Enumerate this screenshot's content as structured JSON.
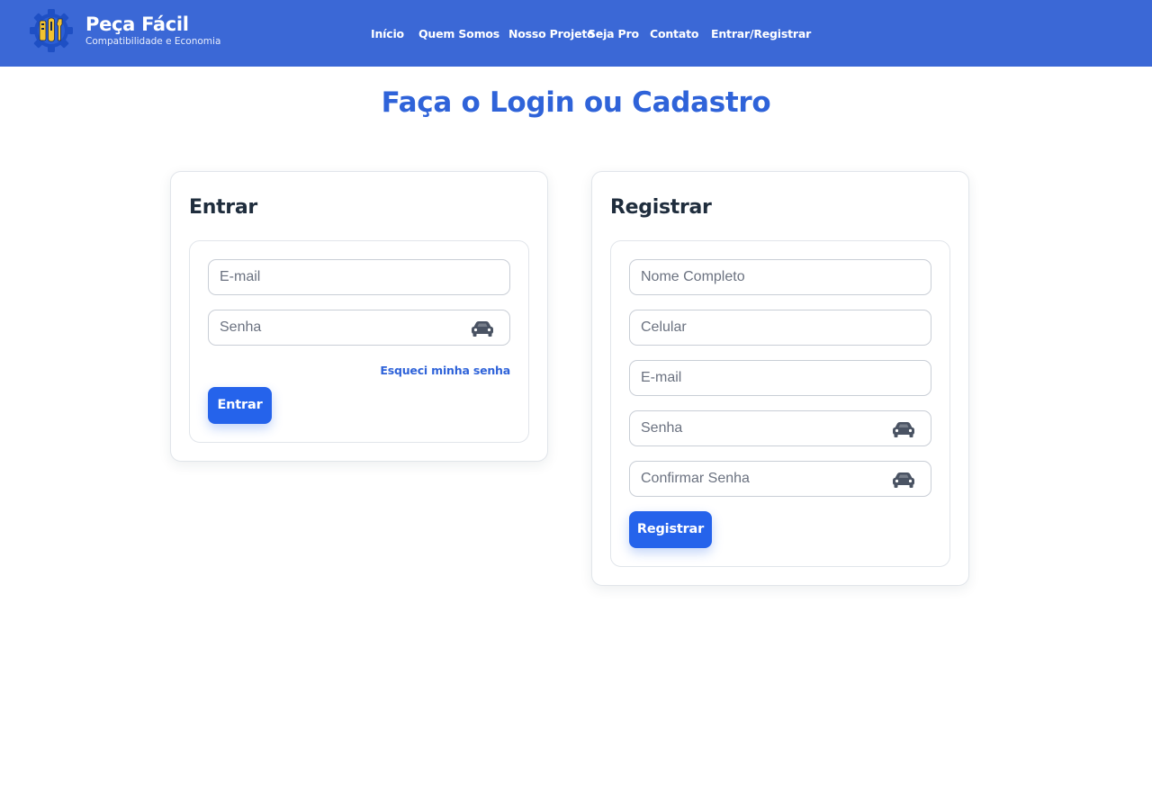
{
  "header": {
    "brand_name": "Peça Fácil",
    "brand_tagline": "Compatibilidade e Economia",
    "logo_icon": "gear-tools-logo-icon",
    "nav": [
      {
        "label": "Início"
      },
      {
        "label": "Quem Somos"
      },
      {
        "label": "Nosso Projeto"
      },
      {
        "label": "Seja Pro"
      },
      {
        "label": "Contato"
      },
      {
        "label": "Entrar/Registrar"
      }
    ]
  },
  "page": {
    "title": "Faça o Login ou Cadastro"
  },
  "login": {
    "title": "Entrar",
    "email_placeholder": "E-mail",
    "password_placeholder": "Senha",
    "password_toggle_icon": "car-icon",
    "forgot_label": "Esqueci minha senha",
    "submit_label": "Entrar"
  },
  "register": {
    "title": "Registrar",
    "name_placeholder": "Nome Completo",
    "phone_placeholder": "Celular",
    "email_placeholder": "E-mail",
    "password_placeholder": "Senha",
    "confirm_placeholder": "Confirmar Senha",
    "password_toggle_icon": "car-icon",
    "submit_label": "Registrar"
  },
  "colors": {
    "header_bg": "#3b68d6",
    "accent": "#2563eb",
    "title_blue": "#2f63d9",
    "logo_gear": "#1e4fc4",
    "logo_tools": "#f2c230",
    "icon_gray": "#4a5363"
  }
}
